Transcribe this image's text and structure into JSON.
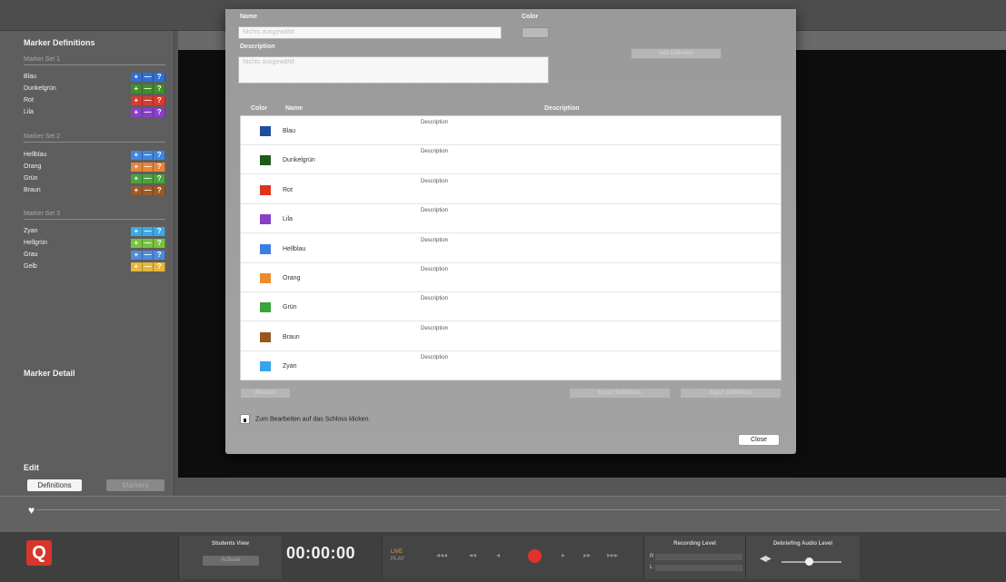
{
  "sidebar": {
    "title": "Marker Definitions",
    "sets": [
      {
        "header": "Marker Set 1",
        "markers": [
          {
            "name": "Blau",
            "color": "#2e6fd6"
          },
          {
            "name": "Dunkelgrün",
            "color": "#3f8f2a"
          },
          {
            "name": "Rot",
            "color": "#d83a2f"
          },
          {
            "name": "Lila",
            "color": "#8a3fc6"
          }
        ]
      },
      {
        "header": "Marker Set 2",
        "markers": [
          {
            "name": "Hellblau",
            "color": "#3f86e0"
          },
          {
            "name": "Orang",
            "color": "#e8843a"
          },
          {
            "name": "Grün",
            "color": "#4aa33a"
          },
          {
            "name": "Braun",
            "color": "#9a5b2a"
          }
        ]
      },
      {
        "header": "Marker Set 3",
        "markers": [
          {
            "name": "Zyan",
            "color": "#3da9e6"
          },
          {
            "name": "Hellgrün",
            "color": "#76c43c"
          },
          {
            "name": "Grau",
            "color": "#4e8bdb"
          },
          {
            "name": "Gelb",
            "color": "#e7b73a"
          }
        ]
      }
    ],
    "marker_buttons": {
      "add": "+",
      "remove": "—",
      "help": "?"
    },
    "marker_detail": "Marker Detail",
    "edit_title": "Edit",
    "definitions_btn": "Definitions",
    "markers_btn": "Markers"
  },
  "dialog": {
    "name_label": "Name",
    "name_placeholder": "Nichts ausgewählt",
    "color_label": "Color",
    "description_label": "Description",
    "description_placeholder": "Nichts ausgewählt",
    "add_definition": "Add Definition",
    "col_color": "Color",
    "col_name": "Name",
    "col_description": "Description",
    "rows": [
      {
        "name": "Blau",
        "color": "#1d4f9c",
        "description": "Description"
      },
      {
        "name": "Dunkelgrün",
        "color": "#1f5a1a",
        "description": "Description"
      },
      {
        "name": "Rot",
        "color": "#e0341f",
        "description": "Description"
      },
      {
        "name": "Lila",
        "color": "#8a3fc6",
        "description": "Description"
      },
      {
        "name": "Hellblau",
        "color": "#3a7fe0",
        "description": "Description"
      },
      {
        "name": "Orang",
        "color": "#ef8a2c",
        "description": "Description"
      },
      {
        "name": "Grün",
        "color": "#3aa33a",
        "description": "Description"
      },
      {
        "name": "Braun",
        "color": "#99561f",
        "description": "Description"
      },
      {
        "name": "Zyan",
        "color": "#36a5ea",
        "description": "Description"
      }
    ],
    "remove_btn": "Remove",
    "import_btn": "Import Definitions",
    "export_btn": "Export Definitions",
    "lock_text": "Zum Bearbeiten auf das Schloss klicken.",
    "close_btn": "Close"
  },
  "bottom": {
    "logo": "Q",
    "students_view_label": "Students View",
    "students_view_btn": "Activate",
    "timecode": "00:00:00",
    "mode_live": "LIVE",
    "mode_play": "PLAY",
    "transport": [
      "◂◂◂",
      "◂◂",
      "◂",
      "▸",
      "▸▸",
      "▸▸▸"
    ],
    "recording_level_label": "Recording Level",
    "rec_channels": [
      "R",
      "L"
    ],
    "debriefing_label": "Debriefing Audio Level"
  }
}
